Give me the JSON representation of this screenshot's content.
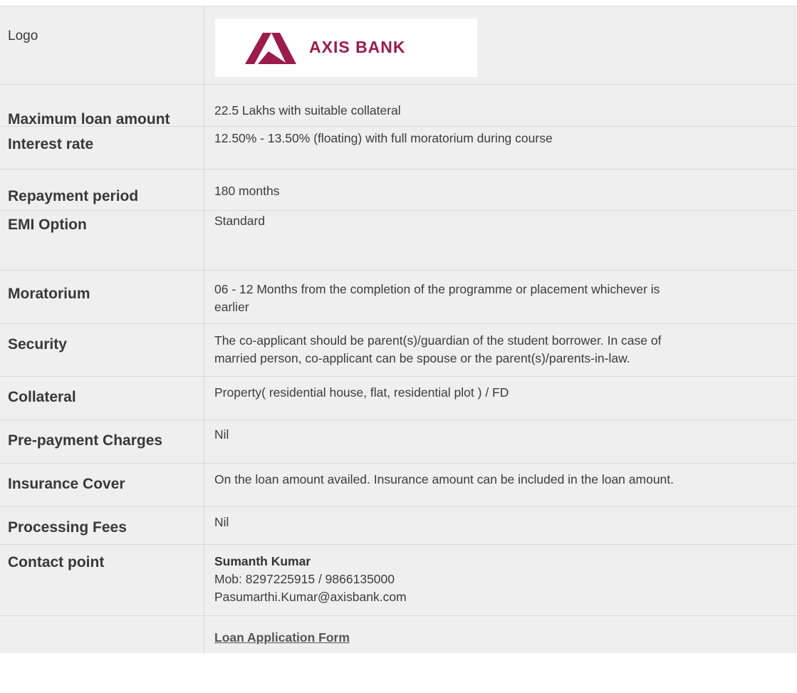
{
  "logo": {
    "label": "Logo",
    "brand_text": "AXIS BANK",
    "brand_color": "#9b1b4c"
  },
  "rows": [
    {
      "label": "Maximum loan amount",
      "value": [
        "22.5 Lakhs with suitable collateral"
      ]
    },
    {
      "label": "Interest rate",
      "value": [
        "12.50% - 13.50% (floating) with full moratorium during course"
      ]
    },
    {
      "label": "Repayment period",
      "value": [
        "180 months"
      ]
    },
    {
      "label": "EMI Option",
      "value": [
        "Standard"
      ]
    },
    {
      "label": "Moratorium",
      "value": [
        "06 - 12 Months from the completion of the programme or placement whichever is",
        "earlier"
      ]
    },
    {
      "label": "Security",
      "value": [
        "The co-applicant should be parent(s)/guardian of the student borrower. In case of",
        "married person, co-applicant can be spouse or the parent(s)/parents-in-law."
      ]
    },
    {
      "label": "Collateral",
      "value": [
        "Property( residential house, flat, residential plot ) / FD"
      ]
    },
    {
      "label": "Pre-payment Charges",
      "value": [
        "Nil"
      ]
    },
    {
      "label": "Insurance Cover",
      "value": [
        "On the loan amount availed. Insurance amount can be included in the loan amount."
      ]
    },
    {
      "label": "Processing Fees",
      "value": [
        "Nil"
      ]
    }
  ],
  "contact": {
    "label": "Contact point",
    "name": "Sumanth Kumar",
    "mobile": "Mob: 8297225915 / 9866135000",
    "email": "Pasumarthi.Kumar@axisbank.com"
  },
  "footer": {
    "link_text": "Loan Application Form"
  }
}
